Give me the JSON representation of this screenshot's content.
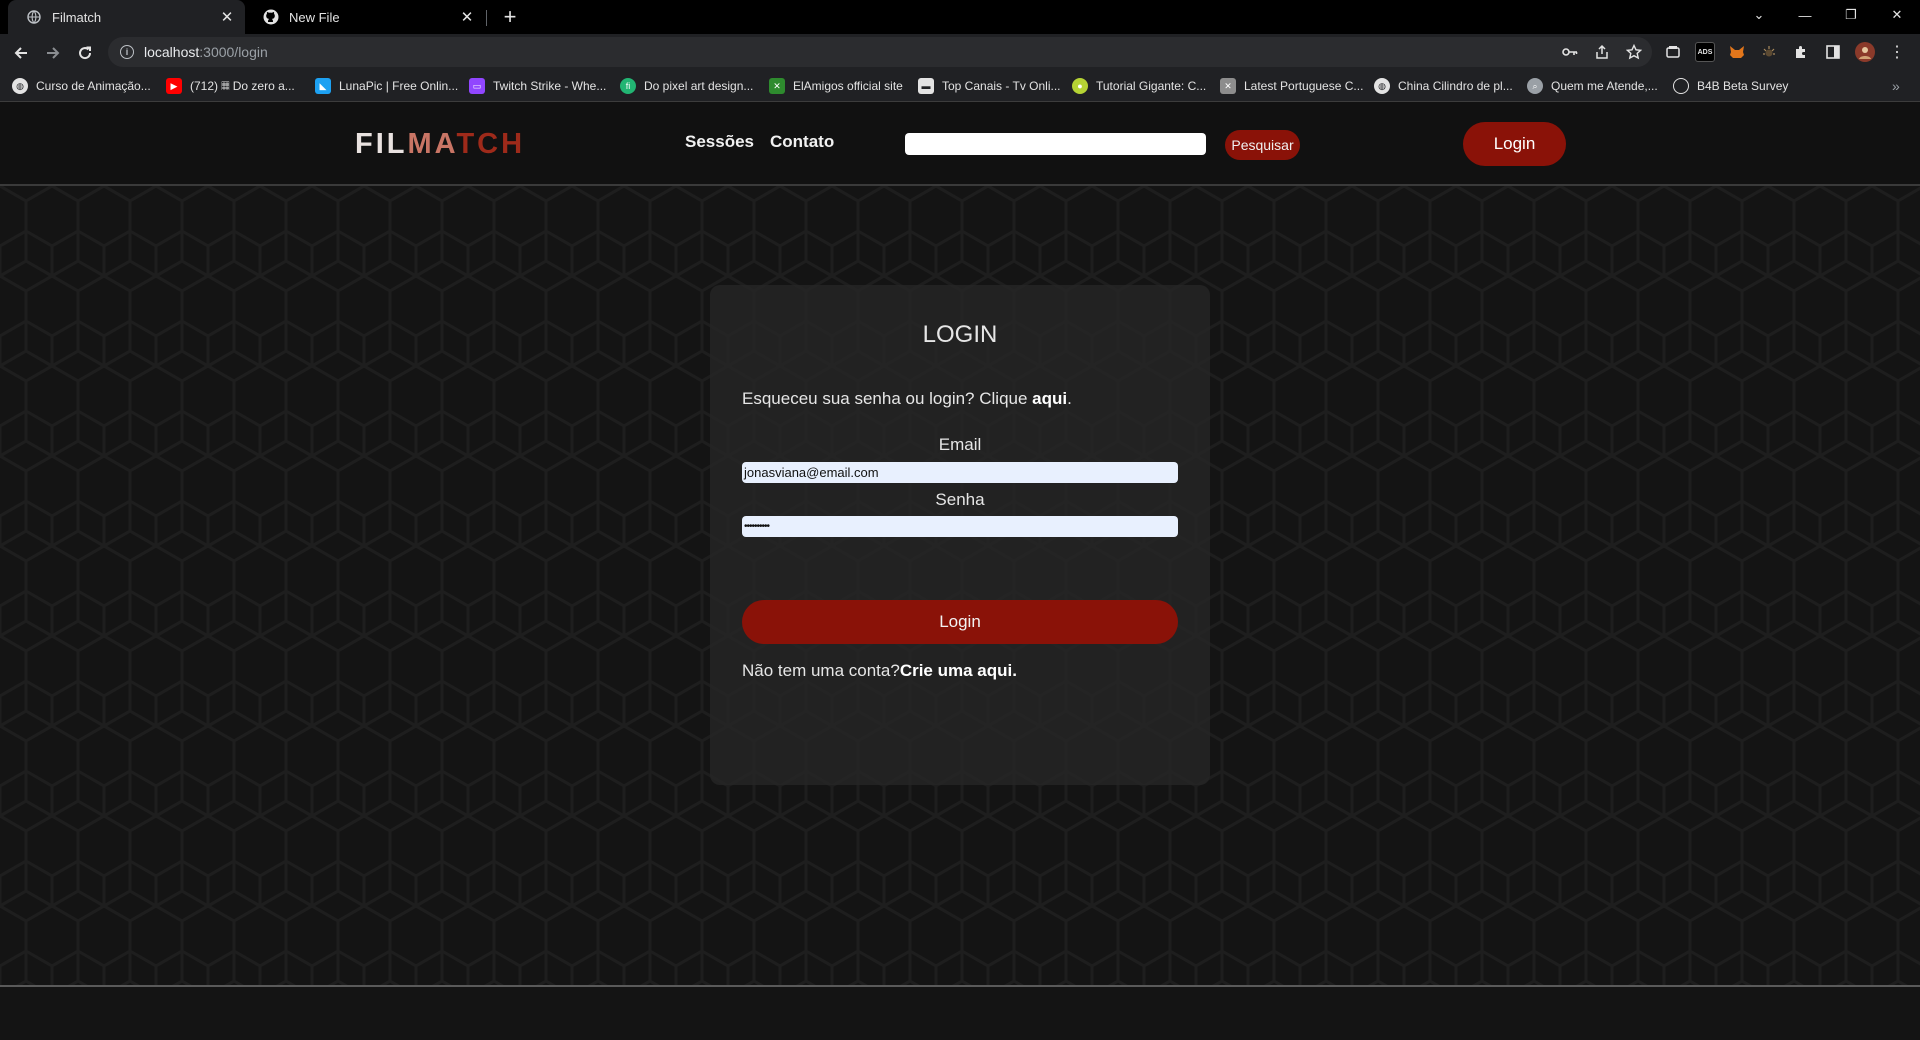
{
  "browser": {
    "tabs": [
      {
        "title": "Filmatch",
        "active": true,
        "icon": "globe-icon"
      },
      {
        "title": "New File",
        "active": false,
        "icon": "github-icon"
      }
    ],
    "close_glyph": "✕",
    "new_tab_glyph": "+",
    "window_controls": [
      "⌄",
      "—",
      "❐",
      "✕"
    ],
    "url_host": "localhost",
    "url_path": ":3000/login",
    "bookmarks": [
      {
        "label": "Curso de Animação...",
        "icon_color": "#e3e3e3"
      },
      {
        "label": "(712) 𝄜 Do zero a...",
        "icon_color": "#ff0000"
      },
      {
        "label": "LunaPic | Free Onlin...",
        "icon_color": "#1da1f2"
      },
      {
        "label": "Twitch Strike - Whe...",
        "icon_color": "#9146ff"
      },
      {
        "label": "Do pixel art design...",
        "icon_color": "#22b573"
      },
      {
        "label": "ElAmigos official site",
        "icon_color": "#2e8b2e"
      },
      {
        "label": "Top Canais - Tv Onli...",
        "icon_color": "#e3e3e3"
      },
      {
        "label": "Tutorial Gigante: C...",
        "icon_color": "#b5d334"
      },
      {
        "label": "Latest Portuguese C...",
        "icon_color": "#8d8d8d"
      },
      {
        "label": "China Cilindro de pl...",
        "icon_color": "#e3e3e3"
      },
      {
        "label": "Quem me Atende,...",
        "icon_color": "#9aa0a6"
      },
      {
        "label": "B4B Beta Survey",
        "icon_color": "#202124"
      }
    ],
    "bookmarks_overflow": "»"
  },
  "site": {
    "logo": {
      "part1": "FIL",
      "part2": "MA",
      "part3": "TCH"
    },
    "nav": [
      "Sessões",
      "Contato"
    ],
    "search_placeholder": "",
    "search_button": "Pesquisar",
    "header_login": "Login"
  },
  "login_card": {
    "title": "LOGIN",
    "forgot_text": "Esqueceu sua senha ou login? Clique ",
    "forgot_link": "aqui",
    "forgot_end": ".",
    "email_label": "Email",
    "email_value": "jonasviana@email.com",
    "password_label": "Senha",
    "password_value": "••••••••••",
    "submit": "Login",
    "signup_text": "Não tem uma conta?",
    "signup_link": "Crie uma aqui."
  },
  "colors": {
    "accent": "#8a1208",
    "background": "#141414",
    "card": "#262626"
  }
}
